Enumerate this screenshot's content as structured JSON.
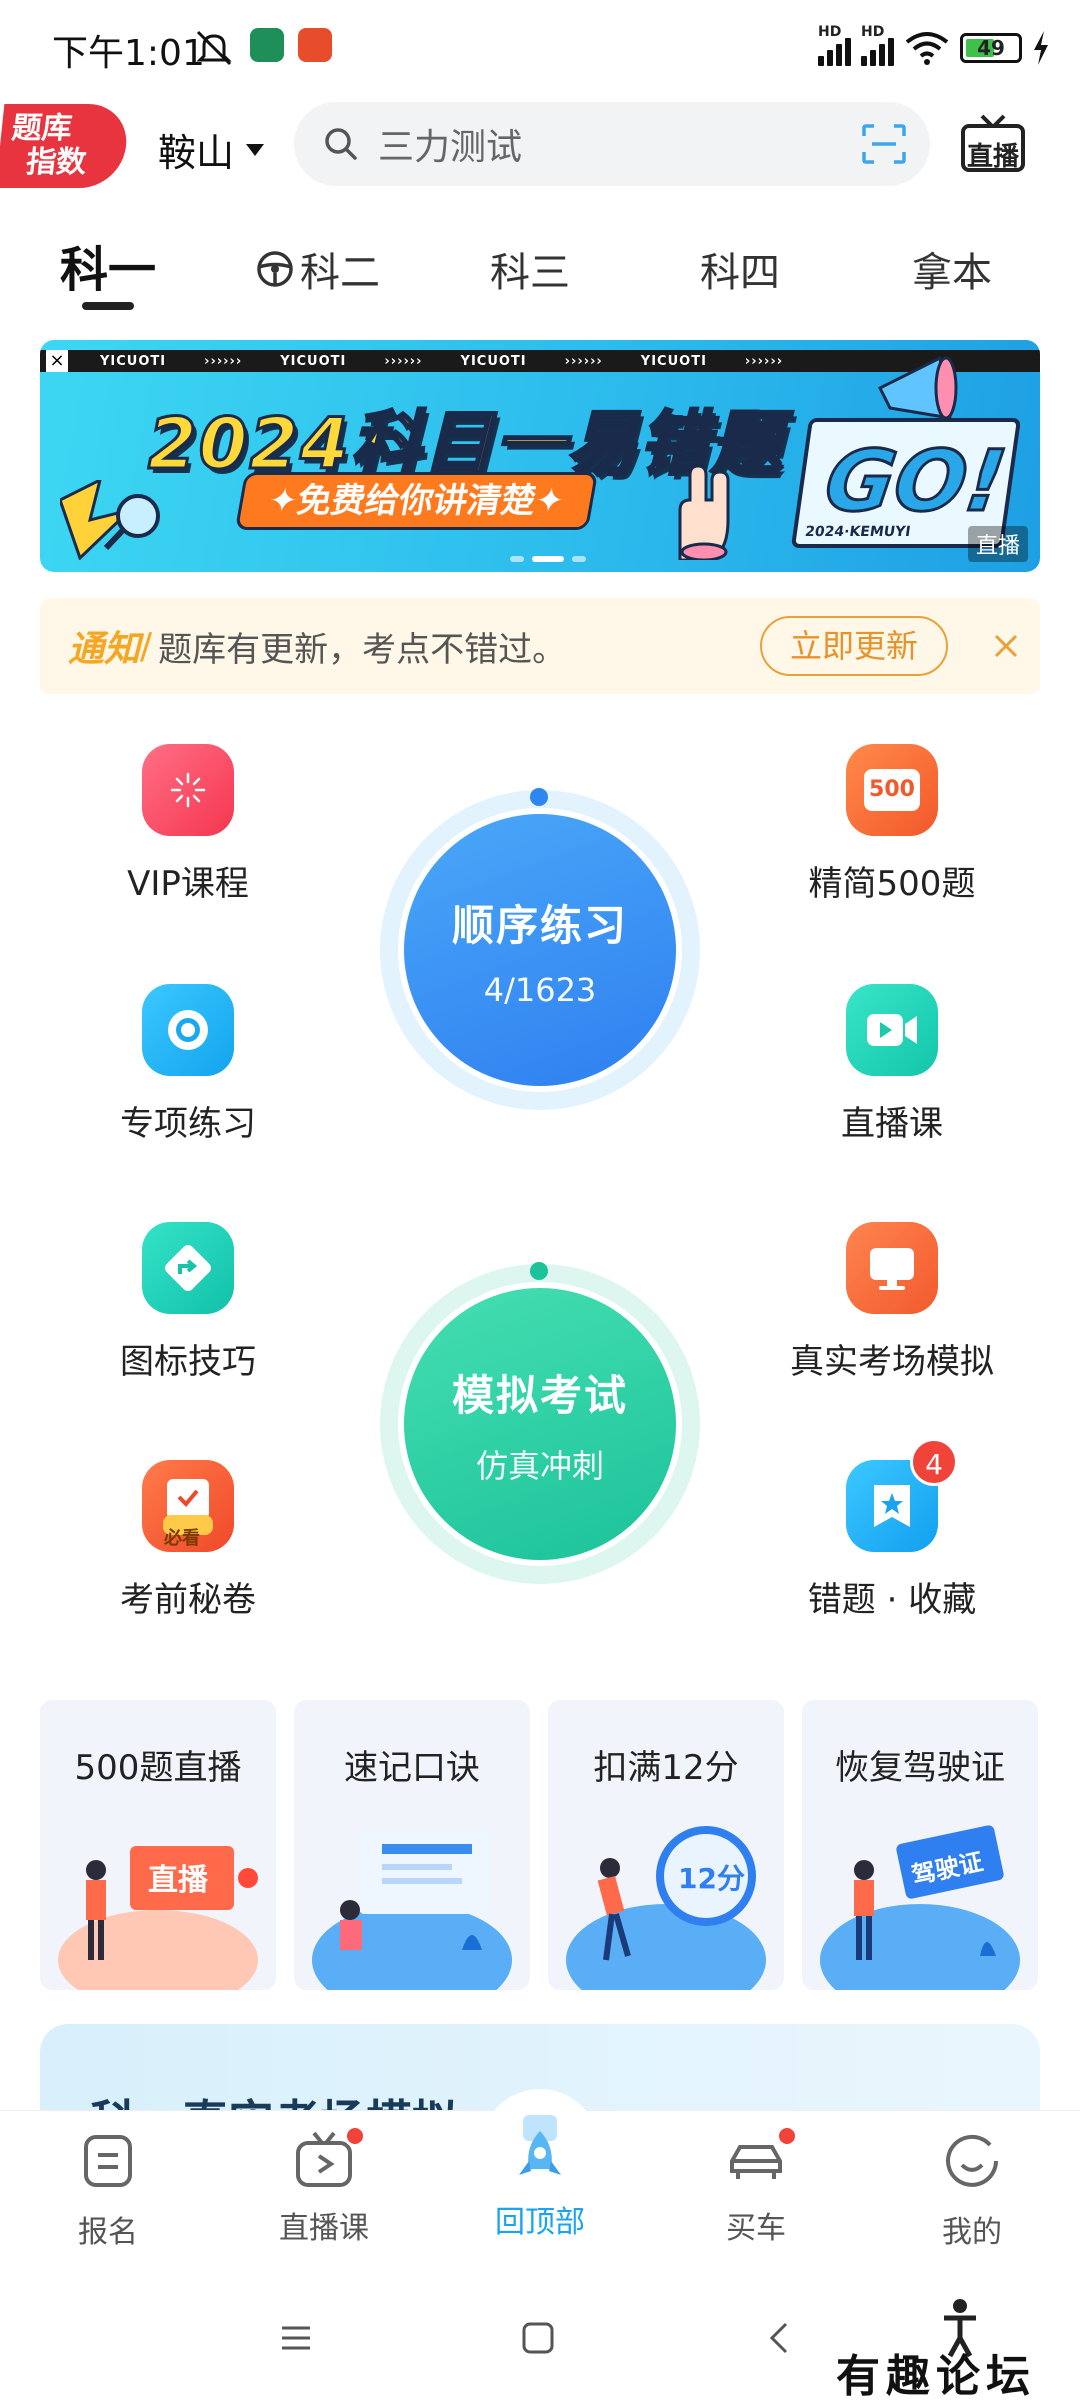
{
  "status_bar": {
    "time": "下午1:01",
    "signal_label_1": "HD",
    "signal_label_2": "HD",
    "battery": "49"
  },
  "header": {
    "brand_badge_line1": "题库",
    "brand_badge_line2": "指数",
    "city": "鞍山",
    "search_placeholder": "三力测试",
    "live_label": "直播"
  },
  "tabs": [
    {
      "label": "科一",
      "active": true
    },
    {
      "label": "科二",
      "active": false
    },
    {
      "label": "科三",
      "active": false
    },
    {
      "label": "科四",
      "active": false
    },
    {
      "label": "拿本",
      "active": false
    }
  ],
  "banner": {
    "strip_text": "YICUOTI",
    "title": "2024科目一易错题",
    "subtitle": "✦免费给你讲清楚✦",
    "go_text": "GO!",
    "go_caption": "2024·KEMUYI",
    "tag": "直播"
  },
  "notice": {
    "label": "通知",
    "text": "题库有更新，考点不错过。",
    "button": "立即更新"
  },
  "features": {
    "vip": "VIP课程",
    "jingjian": "精简500题",
    "zhuanxiang": "专项练习",
    "zhibo": "直播课",
    "tubiao": "图标技巧",
    "zhenshi": "真实考场模拟",
    "kaoqian": "考前秘卷",
    "kaoqian_tag": "必看",
    "cuoti": "错题 · 收藏",
    "cuoti_badge": "4",
    "jingjian_icon_text": "500"
  },
  "main_circles": {
    "sequential_title": "顺序练习",
    "sequential_progress": "4/1623",
    "mock_title": "模拟考试",
    "mock_sub": "仿真冲刺"
  },
  "cards": [
    {
      "title": "500题直播",
      "art_text": "直播"
    },
    {
      "title": "速记口诀",
      "art_text": ""
    },
    {
      "title": "扣满12分",
      "art_text": "12分"
    },
    {
      "title": "恢复驾驶证",
      "art_text": "驾驶证"
    }
  ],
  "promo": {
    "title": "科一真实考场模拟"
  },
  "bottom_nav": [
    {
      "label": "报名"
    },
    {
      "label": "直播课"
    },
    {
      "label": "回顶部"
    },
    {
      "label": "买车"
    },
    {
      "label": "我的"
    }
  ],
  "watermark": "有趣论坛",
  "colors": {
    "accent": "#1aa3f0",
    "sequential_circle": "#3a8df0",
    "mock_circle": "#2fcf9e",
    "badge_red": "#f0433a",
    "notice_orange": "#f5a623"
  }
}
